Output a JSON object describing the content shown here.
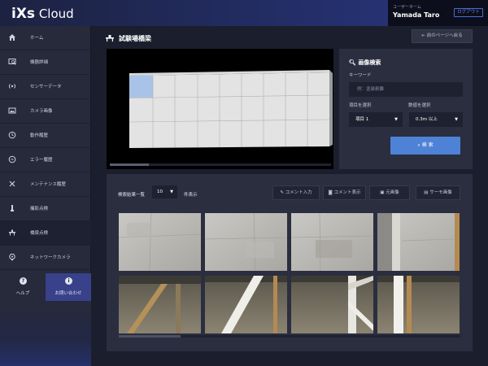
{
  "app": {
    "logo_bold": "iXs",
    "logo_rest": " Cloud"
  },
  "user": {
    "role": "ユーザーネーム",
    "name": "Yamada Taro",
    "logout_label": "ログアウト"
  },
  "sidebar": {
    "items": [
      {
        "label": "ホーム",
        "icon": "home-icon"
      },
      {
        "label": "機器詳細",
        "icon": "device-detail-icon"
      },
      {
        "label": "センサーデータ",
        "icon": "sensor-icon"
      },
      {
        "label": "カメラ画像",
        "icon": "image-icon"
      },
      {
        "label": "動作履歴",
        "icon": "clock-icon"
      },
      {
        "label": "エラー履歴",
        "icon": "error-icon"
      },
      {
        "label": "メンテナンス履歴",
        "icon": "wrench-icon"
      },
      {
        "label": "撮影点検",
        "icon": "camera-arm-icon"
      },
      {
        "label": "橋梁点検",
        "icon": "bridge-icon"
      },
      {
        "label": "ネットワークカメラ",
        "icon": "network-camera-icon"
      }
    ],
    "active_index": 8,
    "help_label": "ヘルプ",
    "contact_label": "お問い合わせ"
  },
  "page": {
    "title": "試験場橋梁",
    "back_label": "前のページへ戻る"
  },
  "search": {
    "title": "画像検索",
    "keyword_label": "キーワード",
    "keyword_placeholder": "例：塗装剥離",
    "item_label": "項目を選択",
    "item_value": "項目 1",
    "number_label": "数値を選択",
    "number_value": "0.3m 以上",
    "search_button": "検 索"
  },
  "results": {
    "label": "検索結果一覧",
    "count_value": "10",
    "suffix": "件表示",
    "buttons": {
      "comment_input": "コメント入力",
      "comment_show": "コメント表示",
      "original_image": "元画像",
      "thermo_image": "サーモ画像"
    }
  },
  "colors": {
    "accent": "#4d82d6",
    "active_cell": "#a9c3e8",
    "topbar_end": "#283680"
  }
}
